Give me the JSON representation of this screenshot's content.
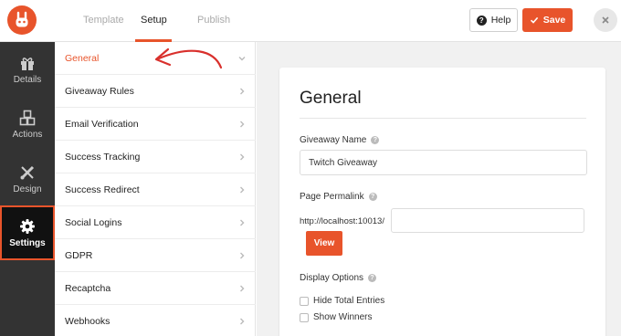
{
  "header": {
    "tabs": [
      {
        "label": "Template",
        "active": false
      },
      {
        "label": "Setup",
        "active": true
      },
      {
        "label": "Publish",
        "active": false
      }
    ],
    "help_label": "Help",
    "save_label": "Save"
  },
  "rail": {
    "items": [
      {
        "label": "Details",
        "icon": "gift-icon",
        "active": false
      },
      {
        "label": "Actions",
        "icon": "cubes-icon",
        "active": false
      },
      {
        "label": "Design",
        "icon": "brush-ruler-icon",
        "active": false
      },
      {
        "label": "Settings",
        "icon": "gear-icon",
        "active": true
      }
    ]
  },
  "subnav": {
    "items": [
      {
        "label": "General",
        "active": true
      },
      {
        "label": "Giveaway Rules",
        "active": false
      },
      {
        "label": "Email Verification",
        "active": false
      },
      {
        "label": "Success Tracking",
        "active": false
      },
      {
        "label": "Success Redirect",
        "active": false
      },
      {
        "label": "Social Logins",
        "active": false
      },
      {
        "label": "GDPR",
        "active": false
      },
      {
        "label": "Recaptcha",
        "active": false
      },
      {
        "label": "Webhooks",
        "active": false
      }
    ]
  },
  "main": {
    "title": "General",
    "giveaway_name": {
      "label": "Giveaway Name",
      "value": "Twitch Giveaway"
    },
    "permalink": {
      "label": "Page Permalink",
      "prefix": "http://localhost:10013/",
      "value": "",
      "view_label": "View"
    },
    "display_options": {
      "label": "Display Options",
      "options": [
        {
          "label": "Hide Total Entries",
          "checked": false
        },
        {
          "label": "Show Winners",
          "checked": false
        }
      ]
    }
  },
  "colors": {
    "accent": "#e8542b",
    "rail_bg": "#333333",
    "content_bg": "#f1f1f1"
  }
}
